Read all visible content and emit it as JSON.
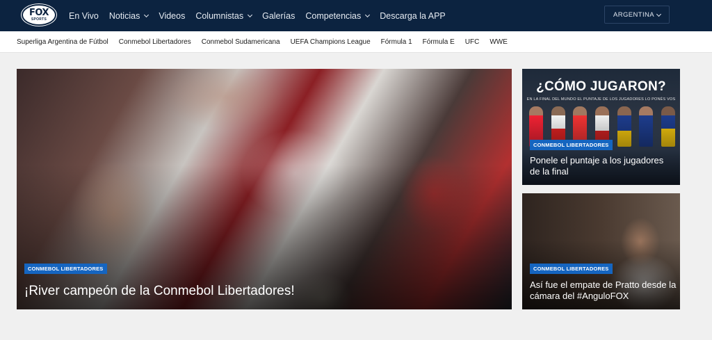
{
  "logo": {
    "line1": "FOX",
    "line2": "SPORTS"
  },
  "nav": {
    "items": [
      {
        "label": "En Vivo",
        "dropdown": false
      },
      {
        "label": "Noticias",
        "dropdown": true
      },
      {
        "label": "Videos",
        "dropdown": false
      },
      {
        "label": "Columnistas",
        "dropdown": true
      },
      {
        "label": "Galerías",
        "dropdown": false
      },
      {
        "label": "Competencias",
        "dropdown": true
      },
      {
        "label": "Descarga la APP",
        "dropdown": false
      }
    ],
    "country": "ARGENTINA"
  },
  "subnav": {
    "items": [
      "Superliga Argentina de Fútbol",
      "Conmebol Libertadores",
      "Conmebol Sudamericana",
      "UEFA Champions League",
      "Fórmula 1",
      "Fórmula E",
      "UFC",
      "WWE"
    ]
  },
  "hero": {
    "badge": "CONMEBOL LIBERTADORES",
    "headline": "¡River campeón de la Conmebol Libertadores!"
  },
  "side1": {
    "banner": "¿CÓMO JUGARON?",
    "banner_sub": "EN LA FINAL DEL MUNDO  EL PUNTAJE DE LOS JUGADORES LO PONÉS VOS",
    "badge": "CONMEBOL LIBERTADORES",
    "headline": "Ponele el puntaje a los jugadores de la final"
  },
  "side2": {
    "badge": "CONMEBOL LIBERTADORES",
    "headline": "Así fue el empate de Pratto desde la cámara del #AnguloFOX"
  },
  "colors": {
    "navbar": "#0c2340",
    "badge": "#1565c0",
    "page_bg": "#f0f0f0"
  }
}
